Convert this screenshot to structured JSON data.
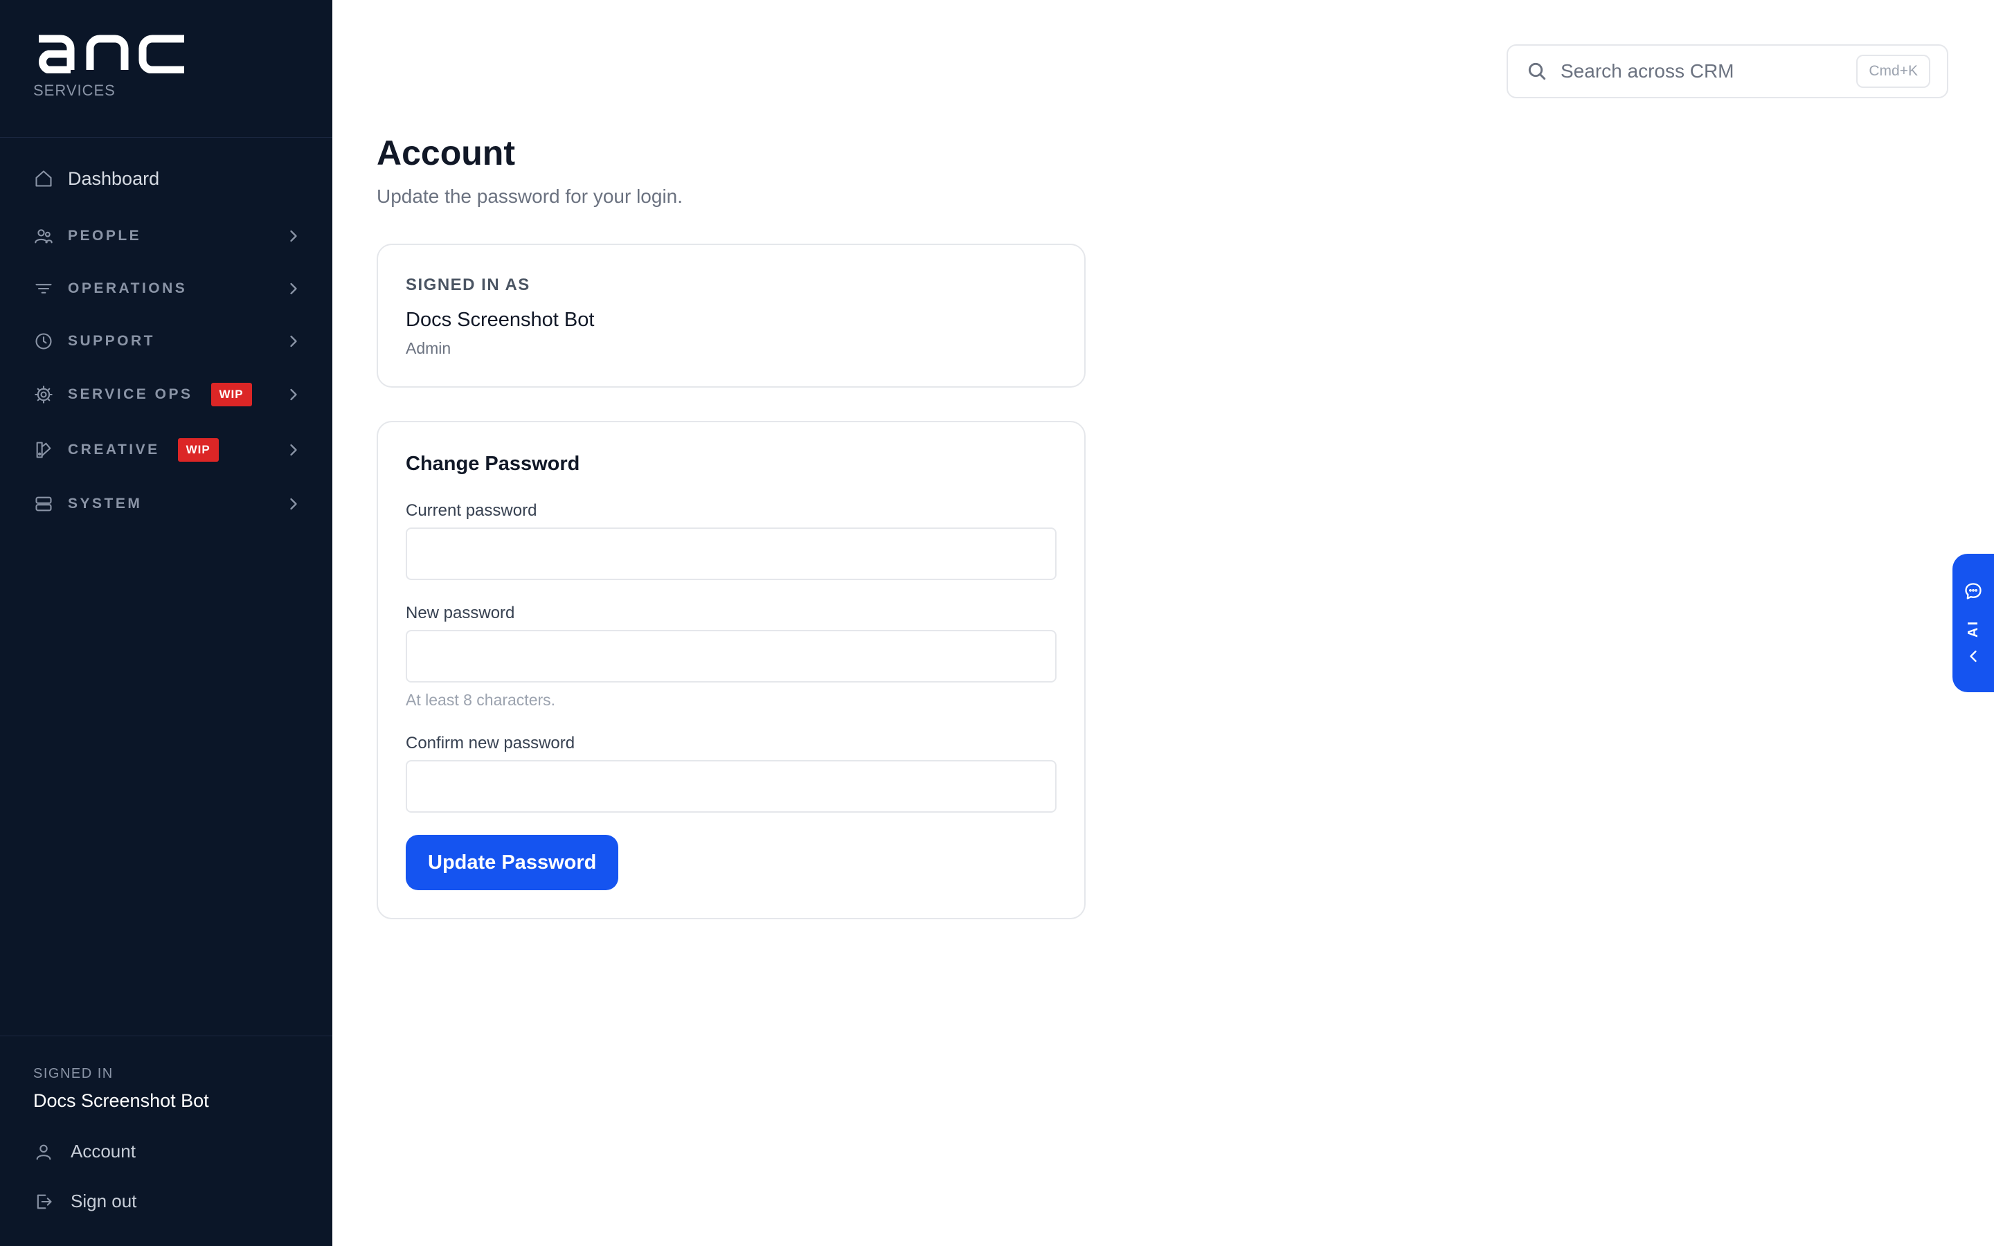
{
  "brand": {
    "name": "anc",
    "subtitle": "SERVICES"
  },
  "search": {
    "placeholder": "Search across CRM",
    "shortcut": "Cmd+K"
  },
  "sidebar": {
    "dashboard": "Dashboard",
    "items": [
      {
        "label": "PEOPLE",
        "icon": "users-icon"
      },
      {
        "label": "OPERATIONS",
        "icon": "filter-icon"
      },
      {
        "label": "SUPPORT",
        "icon": "clock-icon"
      },
      {
        "label": "SERVICE OPS",
        "icon": "gear-icon",
        "badge": "WIP"
      },
      {
        "label": "CREATIVE",
        "icon": "palette-icon",
        "badge": "WIP"
      },
      {
        "label": "SYSTEM",
        "icon": "server-icon"
      }
    ],
    "footer": {
      "signed_in_label": "SIGNED IN",
      "user": "Docs Screenshot Bot",
      "account": "Account",
      "sign_out": "Sign out"
    }
  },
  "page": {
    "title": "Account",
    "subtitle": "Update the password for your login."
  },
  "signed_in_card": {
    "label": "SIGNED IN AS",
    "name": "Docs Screenshot Bot",
    "role": "Admin"
  },
  "password_form": {
    "heading": "Change Password",
    "current_label": "Current password",
    "new_label": "New password",
    "new_hint": "At least 8 characters.",
    "confirm_label": "Confirm new password",
    "submit": "Update Password"
  },
  "ai_tab": {
    "label": "AI"
  },
  "colors": {
    "sidebar_bg": "#0b1628",
    "accent": "#1554f0",
    "badge": "#dc2626"
  }
}
